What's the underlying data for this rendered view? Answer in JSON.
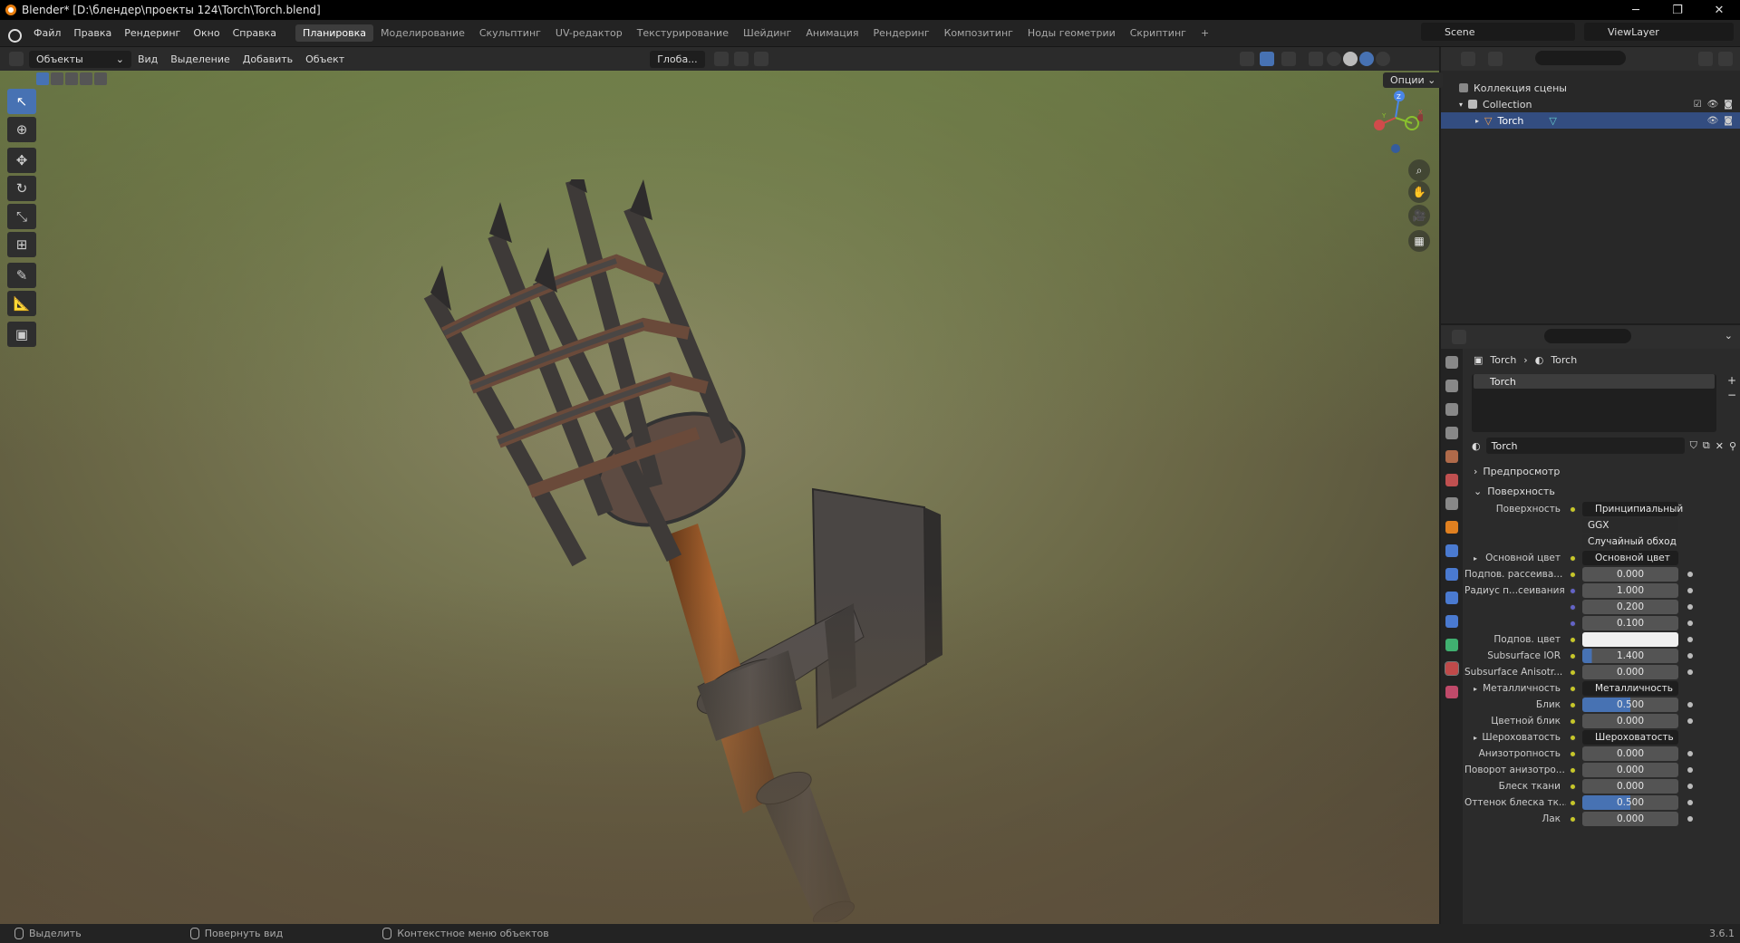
{
  "title": "Blender* [D:\\блендер\\проекты 124\\Torch\\Torch.blend]",
  "menu": [
    "Файл",
    "Правка",
    "Рендеринг",
    "Окно",
    "Справка"
  ],
  "workspaces": [
    "Планировка",
    "Моделирование",
    "Скульптинг",
    "UV-редактор",
    "Текстурирование",
    "Шейдинг",
    "Анимация",
    "Рендеринг",
    "Композитинг",
    "Ноды геометрии",
    "Скриптинг",
    "+"
  ],
  "scene": "Scene",
  "view_layer": "ViewLayer",
  "viewport_header": {
    "mode": "Объекты",
    "items": [
      "Вид",
      "Выделение",
      "Добавить",
      "Объект"
    ],
    "transform": "Глоба...",
    "options": "Опции"
  },
  "gizmo": {
    "z": "Z",
    "y": "Y",
    "x": "X"
  },
  "outliner": {
    "scene_collection": "Коллекция сцены",
    "collection": "Collection",
    "object": "Torch"
  },
  "properties": {
    "breadcrumb": [
      "Torch",
      "Torch"
    ],
    "slot": "Torch",
    "material_name": "Torch",
    "panels": {
      "preview": "Предпросмотр",
      "surface": "Поверхность"
    },
    "rows": [
      {
        "label": "Поверхность",
        "value": "Принципиальный BSDF",
        "kind": "link"
      },
      {
        "label": "",
        "value": "GGX",
        "kind": "select"
      },
      {
        "label": "",
        "value": "Случайный обход",
        "kind": "select"
      },
      {
        "label": "Основной цвет",
        "value": "Основной цвет",
        "kind": "link",
        "arrow": true
      },
      {
        "label": "Подпов. рассеива...",
        "value": "0.000",
        "kind": "num"
      },
      {
        "label": "Радиус п...сеивания",
        "value": "1.000",
        "kind": "vec"
      },
      {
        "label": "",
        "value": "0.200",
        "kind": "vec"
      },
      {
        "label": "",
        "value": "0.100",
        "kind": "vec"
      },
      {
        "label": "Подпов. цвет",
        "value": "",
        "kind": "color"
      },
      {
        "label": "Subsurface IOR",
        "value": "1.400",
        "kind": "sub"
      },
      {
        "label": "Subsurface Anisotr...",
        "value": "0.000",
        "kind": "num"
      },
      {
        "label": "Металличность",
        "value": "Металличность",
        "kind": "link",
        "arrow": true
      },
      {
        "label": "Блик",
        "value": "0.500",
        "kind": "blue"
      },
      {
        "label": "Цветной блик",
        "value": "0.000",
        "kind": "num"
      },
      {
        "label": "Шероховатость",
        "value": "Шероховатость",
        "kind": "link",
        "arrow": true
      },
      {
        "label": "Анизотропность",
        "value": "0.000",
        "kind": "num"
      },
      {
        "label": "Поворот анизотро...",
        "value": "0.000",
        "kind": "num"
      },
      {
        "label": "Блеск ткани",
        "value": "0.000",
        "kind": "num"
      },
      {
        "label": "Оттенок блеска тк...",
        "value": "0.500",
        "kind": "blue"
      },
      {
        "label": "Лак",
        "value": "0.000",
        "kind": "num"
      }
    ]
  },
  "status": {
    "select": "Выделить",
    "rotate": "Повернуть вид",
    "context": "Контекстное меню объектов",
    "version": "3.6.1"
  }
}
